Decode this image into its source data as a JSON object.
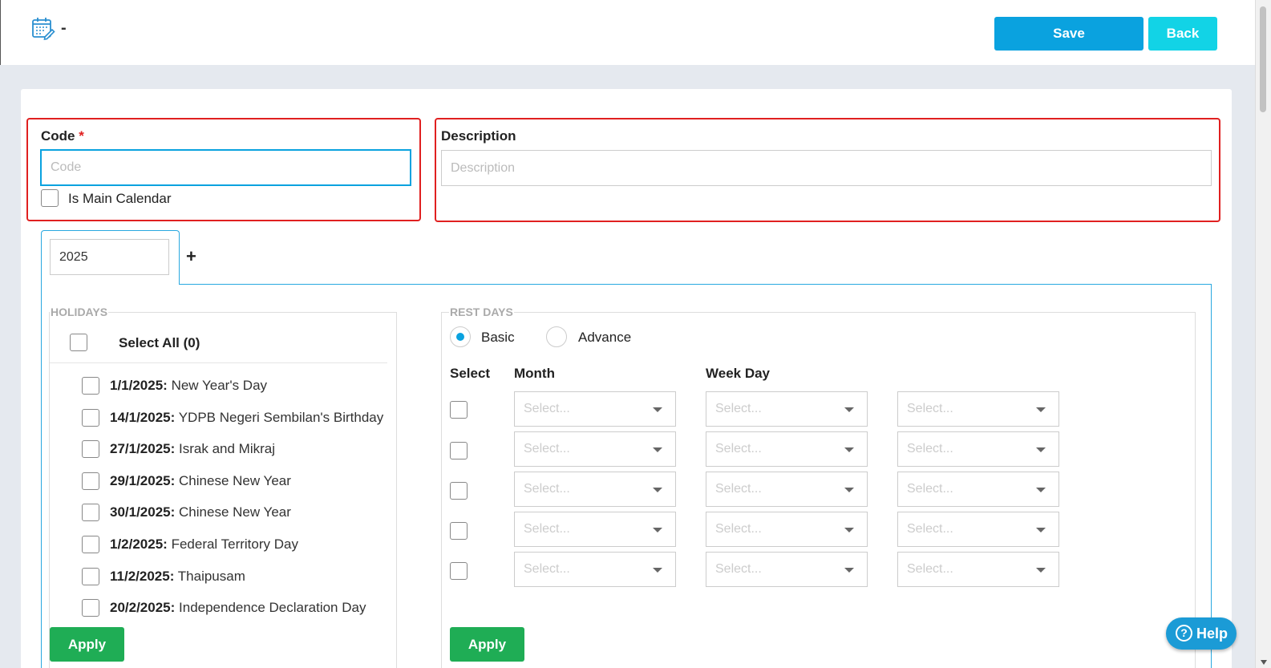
{
  "header": {
    "title": "-",
    "save_label": "Save",
    "back_label": "Back",
    "icon": "calendar-edit-icon"
  },
  "form": {
    "code_label": "Code",
    "code_required": "*",
    "code_value": "",
    "code_placeholder": "Code",
    "description_label": "Description",
    "description_value": "",
    "description_placeholder": "Description",
    "is_main_calendar_label": "Is Main Calendar",
    "is_main_calendar_checked": false
  },
  "year_tab": {
    "value": "2025",
    "add_label": "+"
  },
  "holidays": {
    "legend": "HOLIDAYS",
    "select_all_label": "Select All (0)",
    "items": [
      {
        "date": "1/1/2025:",
        "name": " New Year's Day"
      },
      {
        "date": "14/1/2025:",
        "name": " YDPB Negeri Sembilan's Birthday"
      },
      {
        "date": "27/1/2025:",
        "name": " Israk and Mikraj"
      },
      {
        "date": "29/1/2025:",
        "name": " Chinese New Year"
      },
      {
        "date": "30/1/2025:",
        "name": " Chinese New Year"
      },
      {
        "date": "1/2/2025:",
        "name": " Federal Territory Day"
      },
      {
        "date": "11/2/2025:",
        "name": " Thaipusam"
      },
      {
        "date": "20/2/2025:",
        "name": " Independence Declaration Day"
      }
    ],
    "apply_label": "Apply"
  },
  "rest_days": {
    "legend": "REST DAYS",
    "mode_basic": "Basic",
    "mode_advance": "Advance",
    "selected_mode": "Basic",
    "col_select": "Select",
    "col_month": "Month",
    "col_week_day": "Week Day",
    "select_placeholder": "Select...",
    "row_count": 5,
    "apply_label": "Apply"
  },
  "help": {
    "label": "Help",
    "icon_glyph": "?"
  },
  "colors": {
    "save": "#0aa2df",
    "back": "#12d3e6",
    "apply": "#1fad55",
    "error_outline": "#e02020",
    "help": "#1b9bd6"
  }
}
